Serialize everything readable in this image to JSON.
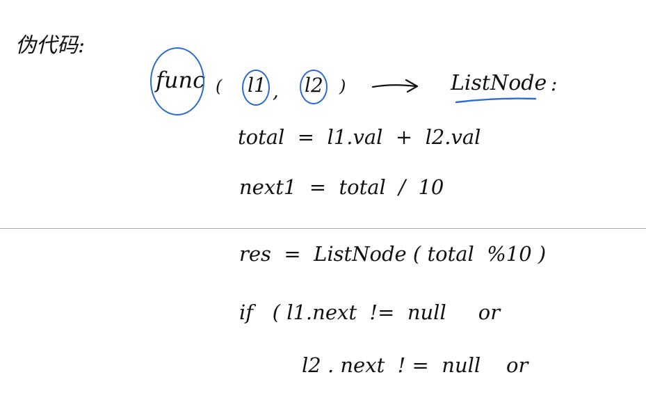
{
  "page": {
    "title": "伪代码:",
    "background": "#ffffff",
    "ink_color": "#111111",
    "annotation_color": "#2a6ad4",
    "divider_color": "#9aa8c0"
  },
  "signature": {
    "func": "func",
    "open_paren": "(",
    "param1": "l1",
    "comma": ",",
    "param2": "l2",
    "close_paren": ")",
    "arrow": "⟶",
    "return_type": "ListNode",
    "colon": ":"
  },
  "lines": [
    {
      "text": "total  =  l1.val  +  l2.val"
    },
    {
      "text": "next1  =  total  /  10"
    },
    {
      "text": "res  =  ListNode ( total  %10 )"
    },
    {
      "text": "if   ( l1.next  !=  null     or"
    },
    {
      "text": "l2 . next  ! =  null    or"
    }
  ]
}
